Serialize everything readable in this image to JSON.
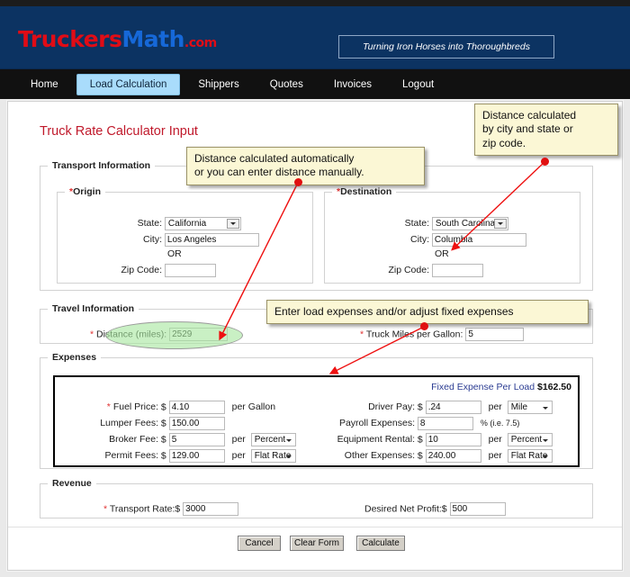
{
  "site": {
    "logo_part1": "Truckers",
    "logo_part2": "Math",
    "logo_part3": ".com",
    "tagline": "Turning Iron Horses into Thoroughbreds",
    "accent_red": "#e00c16",
    "accent_blue": "#1668d8",
    "header_bg": "#0c3362",
    "nav_bg": "#111111",
    "active_tab_bg": "#a9dcfb"
  },
  "nav": {
    "items": [
      {
        "label": "Home",
        "active": false
      },
      {
        "label": "Load Calculation",
        "active": true
      },
      {
        "label": "Shippers",
        "active": false
      },
      {
        "label": "Quotes",
        "active": false
      },
      {
        "label": "Invoices",
        "active": false
      },
      {
        "label": "Logout",
        "active": false
      }
    ]
  },
  "page": {
    "title": "Truck Rate Calculator Input"
  },
  "transport": {
    "legend": "Transport Information",
    "origin": {
      "legend": "Origin",
      "required_marker": "*",
      "state_label": "State:",
      "state_value": "California",
      "city_label": "City:",
      "city_value": "Los Angeles",
      "or_text": "OR",
      "zip_label": "Zip Code:",
      "zip_value": ""
    },
    "destination": {
      "legend": "Destination",
      "required_marker": "*",
      "state_label": "State:",
      "state_value": "South Carolina",
      "city_label": "City:",
      "city_value": "Columbia",
      "or_text": "OR",
      "zip_label": "Zip Code:",
      "zip_value": ""
    }
  },
  "travel": {
    "legend": "Travel Information",
    "distance_label": "Distance (miles):",
    "distance_value": "2529",
    "distance_required": "*",
    "mpg_label": "Truck Miles per Gallon:",
    "mpg_value": "5",
    "mpg_required": "*"
  },
  "expenses": {
    "legend": "Expenses",
    "fixed_expense_label": "Fixed Expense Per Load",
    "fixed_expense_value": "$162.50",
    "left_rows": [
      {
        "label": "Fuel Price:",
        "required": "*",
        "currency": "$",
        "value": "4.10",
        "suffix": "per Gallon",
        "per_label": "",
        "unit": ""
      },
      {
        "label": "Lumper Fees:",
        "required": "",
        "currency": "$",
        "value": "150.00",
        "suffix": "",
        "per_label": "",
        "unit": ""
      },
      {
        "label": "Broker Fee:",
        "required": "",
        "currency": "$",
        "value": "5",
        "suffix": "",
        "per_label": "per",
        "unit": "Percent"
      },
      {
        "label": "Permit Fees:",
        "required": "",
        "currency": "$",
        "value": "129.00",
        "suffix": "",
        "per_label": "per",
        "unit": "Flat Rate"
      }
    ],
    "right_rows": [
      {
        "label": "Driver Pay:",
        "required": "",
        "currency": "$",
        "value": ".24",
        "suffix": "",
        "per_label": "per",
        "unit": "Mile"
      },
      {
        "label": "Payroll Expenses:",
        "required": "",
        "currency": "",
        "value": "8",
        "suffix": "% (i.e. 7.5)",
        "per_label": "",
        "unit": ""
      },
      {
        "label": "Equipment Rental:",
        "required": "",
        "currency": "$",
        "value": "10",
        "suffix": "",
        "per_label": "per",
        "unit": "Percent"
      },
      {
        "label": "Other Expenses:",
        "required": "",
        "currency": "$",
        "value": "240.00",
        "suffix": "",
        "per_label": "per",
        "unit": "Flat Rate"
      }
    ]
  },
  "revenue": {
    "legend": "Revenue",
    "transport_rate_label": "Transport Rate:",
    "transport_rate_required": "*",
    "transport_rate_currency": "$",
    "transport_rate_value": "3000",
    "net_profit_label": "Desired Net Profit:",
    "net_profit_currency": "$",
    "net_profit_value": "500"
  },
  "buttons": {
    "cancel": "Cancel",
    "clear": "Clear Form",
    "calculate": "Calculate"
  },
  "annotations": {
    "callout_distance": "Distance calculated automatically\nor you can enter distance manually.",
    "callout_distance_line1": "Distance calculated automatically",
    "callout_distance_line2": "or you can enter distance manually.",
    "callout_zip_line1": "Distance calculated",
    "callout_zip_line2": "by city and state or",
    "callout_zip_line3": "zip code.",
    "callout_expenses": "Enter load expenses and/or adjust fixed expenses",
    "arrow_color": "#ee1111",
    "highlight_color": "#a8e6a0"
  }
}
